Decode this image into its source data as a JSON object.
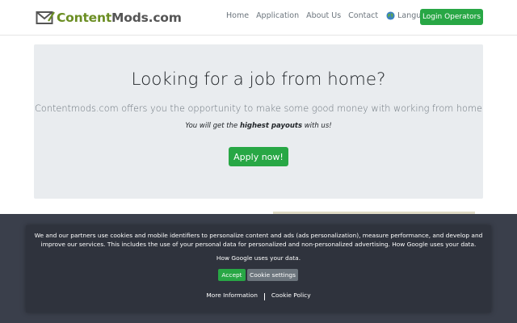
{
  "brand": {
    "part1": "Content",
    "part2": "Mods.com",
    "logo_icon": "envelope-icon",
    "color_primary": "#6b8e23",
    "color_secondary": "#555555"
  },
  "nav": {
    "items": [
      "Home",
      "Application",
      "About Us",
      "Contact"
    ],
    "language_label": "Language",
    "language_icon": "globe-icon",
    "login_label": "Login Operators"
  },
  "hero": {
    "title": "Looking for a job from home?",
    "lead": "Contentmods.com offers you the opportunity to make some good money with working from home",
    "sub_before": "You will get the ",
    "sub_bold": "highest payouts",
    "sub_after": " with us!",
    "button_label": "Apply now!"
  },
  "cookie": {
    "text": "We and our partners use cookies and mobile identifiers to personalize content and ads (ads personalization), measure performance, and develop and improve our services. This includes the use of your personal data for personalized and non-personalized advertising. How Google uses your data.",
    "google_link": "How Google uses your data.",
    "accept_label": "Accept",
    "settings_label": "Cookie settings",
    "more_info_label": "More Information",
    "policy_label": "Cookie Policy"
  },
  "colors": {
    "accent_green": "#28a745",
    "secondary_gray": "#6c757d",
    "jumbotron_bg": "#e9ecef",
    "cookie_bg": "#2f333d"
  }
}
